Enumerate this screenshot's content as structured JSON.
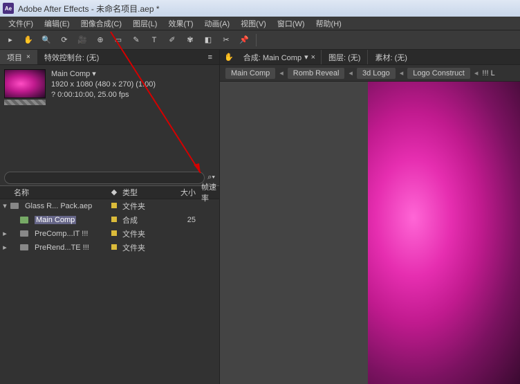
{
  "title": "Adobe After Effects - 未命名项目.aep *",
  "menu": [
    "文件(F)",
    "编辑(E)",
    "图像合成(C)",
    "图层(L)",
    "效果(T)",
    "动画(A)",
    "视图(V)",
    "窗口(W)",
    "帮助(H)"
  ],
  "leftTabs": {
    "project": "项目",
    "fx": "特效控制台: (无)"
  },
  "compInfo": {
    "name": "Main Comp ▾",
    "dims": "1920 x 1080  (480 x 270) (1.00)",
    "dur": "? 0:00:10:00, 25.00 fps"
  },
  "search": {
    "placeholder": ""
  },
  "searchIcon": "⌕▾",
  "cols": {
    "name": "名称",
    "tag": "◆",
    "type": "类型",
    "size": "大小",
    "rate": "帧速率"
  },
  "tree": [
    {
      "tw": "▾",
      "indent": 0,
      "icon": "folder",
      "name": "Glass R... Pack.aep",
      "type": "文件夹",
      "size": "",
      "selected": false
    },
    {
      "tw": "",
      "indent": 1,
      "icon": "comp",
      "name": "Main Comp",
      "type": "合成",
      "size": "25",
      "selected": true
    },
    {
      "tw": "▸",
      "indent": 1,
      "icon": "folder",
      "name": "PreComp...IT !!!",
      "type": "文件夹",
      "size": "",
      "selected": false
    },
    {
      "tw": "▸",
      "indent": 1,
      "icon": "folder",
      "name": "PreRend...TE !!!",
      "type": "文件夹",
      "size": "",
      "selected": false
    }
  ],
  "rightTop": {
    "compLabel": "合成: Main Comp",
    "layerLabel": "图层: (无)",
    "footageLabel": "素材: (无)"
  },
  "breadcrumb": [
    "Main Comp",
    "Romb Reveal",
    "3d Logo",
    "Logo Construct",
    "!!! L"
  ],
  "rightIcons": {
    "hand": "✋",
    "drop": "▾",
    "close": "×",
    "caret": "◂"
  },
  "chart_data": null
}
